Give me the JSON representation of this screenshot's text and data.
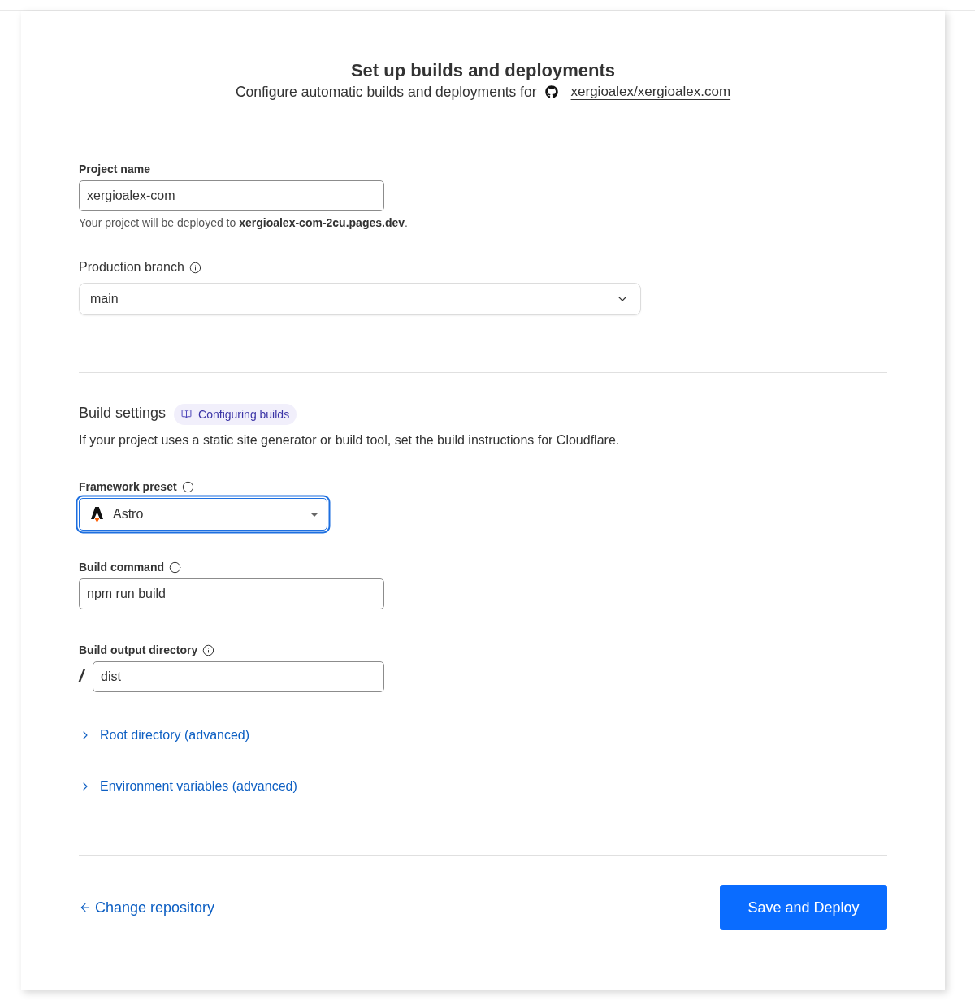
{
  "header": {
    "title": "Set up builds and deployments",
    "subtitle": "Configure automatic builds and deployments for",
    "repository_link": "xergioalex/xergioalex.com"
  },
  "project": {
    "label": "Project name",
    "value": "xergioalex-com",
    "hint": "Your project will be deployed to **xergioalex-com-2cu.pages.dev**."
  },
  "production_branch": {
    "label": "Production branch",
    "info": true,
    "value": "main"
  },
  "build_settings": {
    "title": "Build settings",
    "docs_link": "Configuring builds",
    "description": "If your project uses a static site generator or build tool, set the build instructions for Cloudflare."
  },
  "fields": [
    {
      "kind": "select",
      "label": "Framework preset",
      "info": true,
      "value": "Astro",
      "focused": true
    },
    {
      "kind": "text",
      "label": "Build command",
      "info": true,
      "value": "npm run build",
      "focused": false
    },
    {
      "kind": "prefixed",
      "label": "Build output directory",
      "info": true,
      "prefix": "/",
      "value": "dist",
      "focused": false
    }
  ],
  "advanced": [
    {
      "label": "Root directory (advanced)",
      "expanded": false
    },
    {
      "label": "Environment variables (advanced)",
      "expanded": false
    }
  ],
  "footer": {
    "back_link": "Change repository",
    "primary_button": "Save and Deploy"
  }
}
